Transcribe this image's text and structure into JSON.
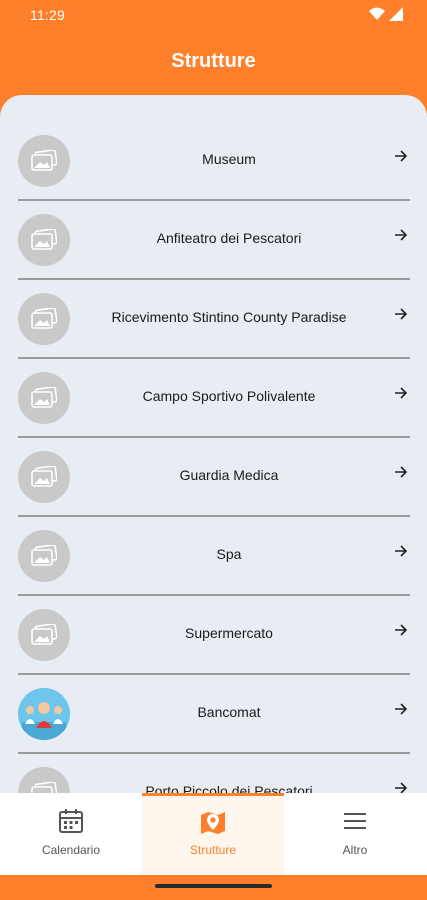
{
  "status_bar": {
    "time": "11:29"
  },
  "header": {
    "title": "Strutture"
  },
  "list": {
    "items": [
      {
        "label": "Museum",
        "thumb": "image-placeholder"
      },
      {
        "label": "Anfiteatro dei Pescatori",
        "thumb": "image-placeholder"
      },
      {
        "label": "Ricevimento Stintino County Paradise",
        "thumb": "image-placeholder"
      },
      {
        "label": "Campo Sportivo Polivalente",
        "thumb": "image-placeholder"
      },
      {
        "label": "Guardia Medica",
        "thumb": "image-placeholder"
      },
      {
        "label": "Spa",
        "thumb": "image-placeholder"
      },
      {
        "label": "Supermercato",
        "thumb": "image-placeholder"
      },
      {
        "label": "Bancomat",
        "thumb": "photo"
      },
      {
        "label": "Porto Piccolo dei Pescatori",
        "thumb": "image-placeholder"
      }
    ]
  },
  "bottom_nav": {
    "items": [
      {
        "label": "Calendario",
        "icon": "calendar-icon"
      },
      {
        "label": "Strutture",
        "icon": "map-pin-icon",
        "active": true
      },
      {
        "label": "Altro",
        "icon": "menu-icon"
      }
    ]
  },
  "colors": {
    "accent": "#FF7F2A",
    "panel": "#E8EDF3",
    "placeholder": "#C9C9C9"
  }
}
